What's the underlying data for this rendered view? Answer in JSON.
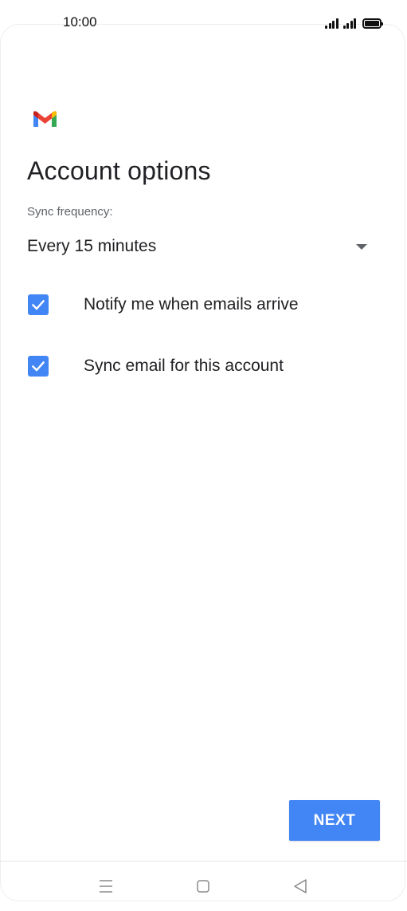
{
  "status_bar": {
    "time": "10:00",
    "icons": [
      "signal-icon",
      "signal-icon",
      "battery-icon"
    ]
  },
  "app": {
    "logo": "gmail-logo-icon",
    "colors": {
      "accent": "#4285f4",
      "gmail_red": "#ea4335",
      "gmail_blue": "#4285f4",
      "gmail_green": "#34a853",
      "gmail_yellow": "#fbbc04"
    }
  },
  "page": {
    "title": "Account options"
  },
  "sync": {
    "label": "Sync frequency:",
    "selected": "Every 15 minutes"
  },
  "options": [
    {
      "label": "Notify me when emails arrive",
      "checked": true
    },
    {
      "label": "Sync email for this account",
      "checked": true
    }
  ],
  "actions": {
    "next_label": "NEXT"
  },
  "nav_bar": {
    "buttons": [
      "menu-icon",
      "home-icon",
      "back-icon"
    ]
  }
}
